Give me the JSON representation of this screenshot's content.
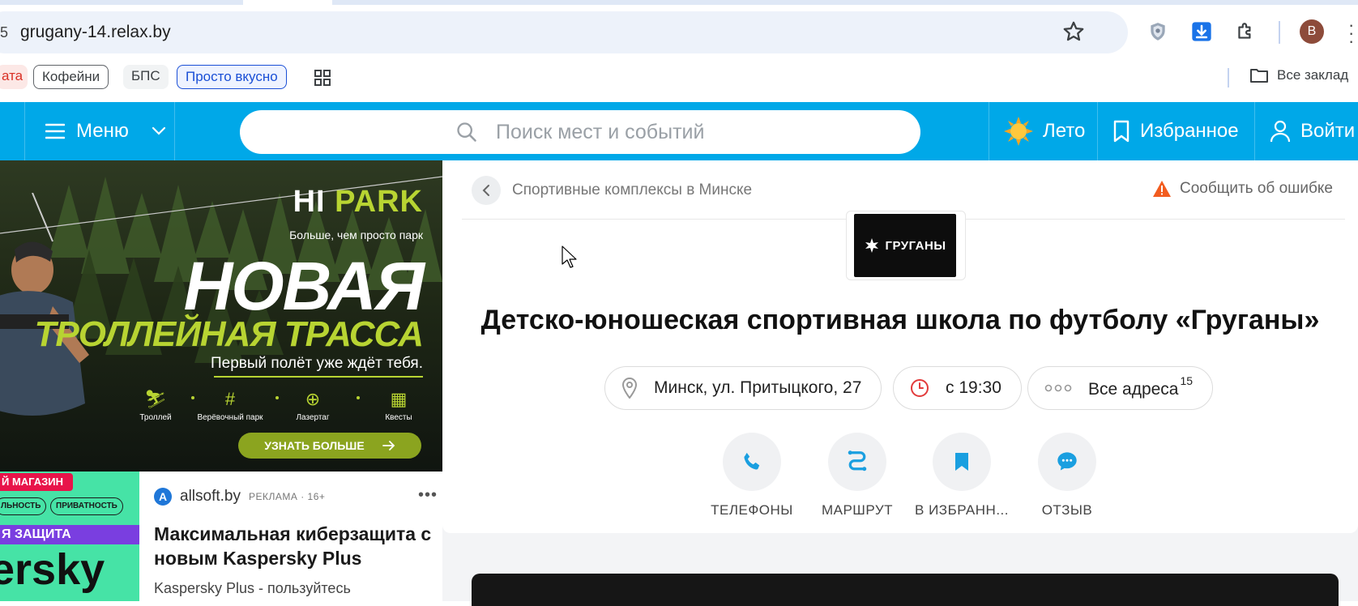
{
  "browser": {
    "url": "grugany-14.relax.by",
    "site_icon_fragment": "5",
    "avatar_letter": "B",
    "bookmarks": [
      {
        "label": "ата",
        "style": "red"
      },
      {
        "label": "Кофейни",
        "style": "outlined"
      },
      {
        "label": "БПС",
        "style": "plain"
      },
      {
        "label": "Просто вкусно",
        "style": "blue"
      }
    ],
    "all_bookmarks_label": "Все заклад",
    "icons": [
      "star-icon",
      "shield-icon",
      "download-icon",
      "extensions-icon",
      "apps-grid-icon",
      "folder-icon"
    ]
  },
  "header": {
    "menu_label": "Меню",
    "search_placeholder": "Поиск мест и событий",
    "season_label": "Лето",
    "favorites_label": "Избранное",
    "login_label": "Войти",
    "brand_color": "#00a8e8"
  },
  "ad_banner": {
    "logo_hi": "HI",
    "logo_park": "PARK",
    "tagline": "Больше, чем просто парк",
    "headline": "НОВАЯ",
    "subheadline": "ТРОЛЛЕЙНАЯ ТРАССА",
    "first_flight": "Первый полёт уже ждёт тебя.",
    "features": [
      "Троллей",
      "Верёвочный парк",
      "Лазертаг",
      "Квесты"
    ],
    "cta": "УЗНАТЬ БОЛЬШЕ"
  },
  "ad_card": {
    "thumb_shop": "Й МАГАЗИН",
    "thumb_chip_1": "ЛЬНОСТЬ",
    "thumb_chip_2": "ПРИВАТНОСТЬ",
    "thumb_band": "Я ЗАЩИТА",
    "thumb_brand": "ersky",
    "source": "allsoft.by",
    "ad_label": "РЕКЛАМА · 16+",
    "title": "Максимальная киберзащита с новым Kaspersky Plus",
    "description": "Kaspersky Plus - пользуйтесь"
  },
  "main": {
    "breadcrumb": "Спортивные комплексы в Минске",
    "report_label": "Сообщить об ошибке",
    "logo_text": "ГРУГАНЫ",
    "title": "Детско-юношеская спортивная школа по футболу «Груганы»",
    "address": "Минск, ул. Притыцкого, 27",
    "hours": "с 19:30",
    "all_addresses": "Все адреса",
    "addresses_count": "15",
    "actions": [
      {
        "label": "ТЕЛЕФОНЫ",
        "icon": "phone-icon"
      },
      {
        "label": "МАРШРУТ",
        "icon": "route-icon"
      },
      {
        "label": "В ИЗБРАНН...",
        "icon": "bookmark-icon"
      },
      {
        "label": "ОТЗЫВ",
        "icon": "chat-icon"
      }
    ]
  }
}
